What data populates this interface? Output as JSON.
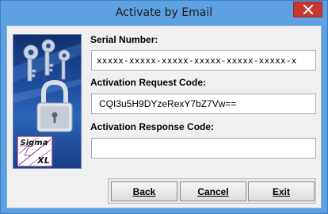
{
  "window": {
    "title": "Activate by Email"
  },
  "logo": {
    "brand_line1": "Sigma",
    "brand_line2": "XL"
  },
  "fields": {
    "serial_label": "Serial Number:",
    "serial_value": "xxxxx-xxxxx-xxxxx-xxxxx-xxxxx-xxxxx-x",
    "request_label": "Activation Request Code:",
    "request_value": "CQI3u5H9DYzeRexY7bZ7Vw==",
    "response_label": "Activation Response Code:",
    "response_value": ""
  },
  "buttons": {
    "back": "Back",
    "cancel": "Cancel",
    "exit": "Exit"
  },
  "colors": {
    "title_bar": "#5ea1e2",
    "close_button": "#c7372f",
    "dialog_bg": "#f0f0f0"
  },
  "icons": {
    "close": "close-icon",
    "padlock": "padlock-icon",
    "keys": "keys-icon"
  }
}
